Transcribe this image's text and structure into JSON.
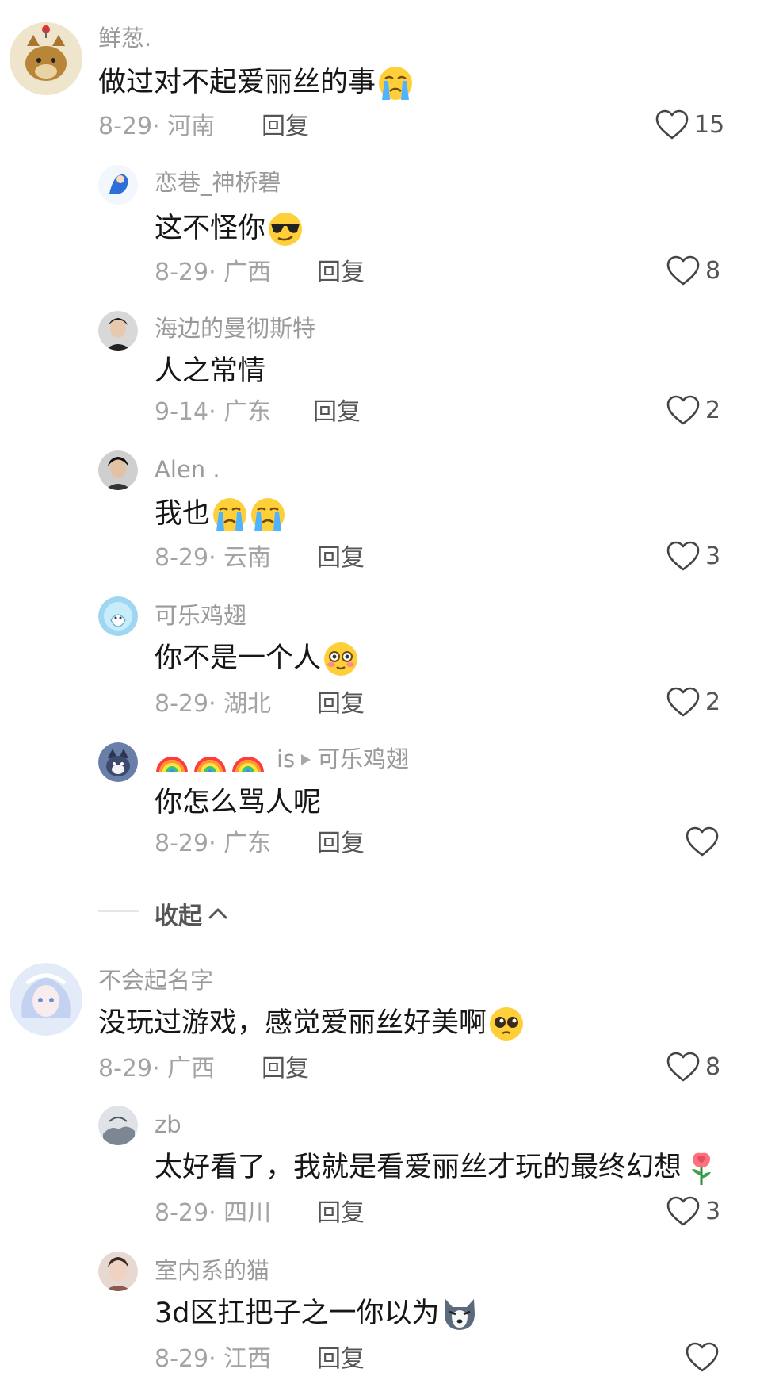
{
  "comments": [
    {
      "user": "鲜葱.",
      "text": "做过对不起爱丽丝的事",
      "meta": "8-29· 河南",
      "reply": "回复",
      "likes": "15"
    },
    {
      "user": "恋巷_神桥碧",
      "text": "这不怪你",
      "meta": "8-29· 广西",
      "reply": "回复",
      "likes": "8"
    },
    {
      "user": "海边的曼彻斯特",
      "text": "人之常情",
      "meta": "9-14· 广东",
      "reply": "回复",
      "likes": "2"
    },
    {
      "user": "Alen .",
      "text": "我也",
      "meta": "8-29· 云南",
      "reply": "回复",
      "likes": "3"
    },
    {
      "user": "可乐鸡翅",
      "text": "你不是一个人",
      "meta": "8-29· 湖北",
      "reply": "回复",
      "likes": "2"
    },
    {
      "user_suffix": "is",
      "reply_to": "可乐鸡翅",
      "text": "你怎么骂人呢",
      "meta": "8-29· 广东",
      "reply": "回复",
      "likes": ""
    },
    {
      "user": "不会起名字",
      "text": "没玩过游戏，感觉爱丽丝好美啊",
      "meta": "8-29· 广西",
      "reply": "回复",
      "likes": "8"
    },
    {
      "user": "zb",
      "text": "太好看了，我就是看爱丽丝才玩的最终幻想",
      "meta": "8-29· 四川",
      "reply": "回复",
      "likes": "3"
    },
    {
      "user": "室内系的猫",
      "text": "3d区扛把子之一你以为",
      "meta": "8-29· 江西",
      "reply": "回复",
      "likes": ""
    }
  ],
  "collapse_label": "收起",
  "icons": {
    "like": "heart-outline-icon",
    "collapse": "chevron-up-icon",
    "reply_arrow": "play-arrow-icon"
  },
  "colors": {
    "username": "#9a9a9a",
    "meta": "#a3a3a3",
    "reply": "#555555"
  }
}
